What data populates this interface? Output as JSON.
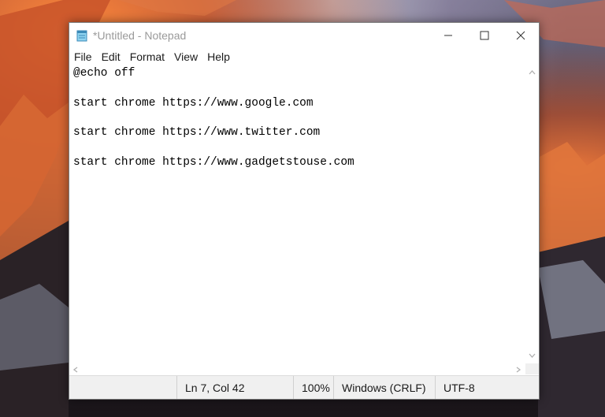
{
  "window": {
    "title": "*Untitled - Notepad"
  },
  "menu": {
    "items": [
      "File",
      "Edit",
      "Format",
      "View",
      "Help"
    ]
  },
  "editor": {
    "lines": [
      "@echo off",
      "start chrome https://www.google.com",
      "start chrome https://www.twitter.com",
      "start chrome https://www.gadgetstouse.com"
    ]
  },
  "status": {
    "position": "Ln 7, Col 42",
    "zoom": "100%",
    "line_ending": "Windows (CRLF)",
    "encoding": "UTF-8"
  },
  "icons": {
    "app": "notepad-icon",
    "minimize": "minimize-icon",
    "maximize": "maximize-icon",
    "close": "close-icon"
  }
}
